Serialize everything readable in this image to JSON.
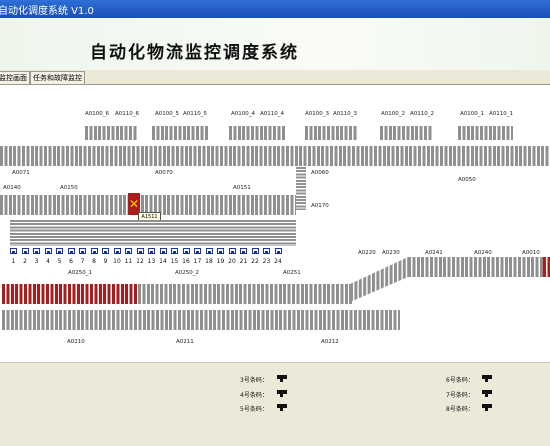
{
  "window": {
    "title": "自动化调度系统  V1.0"
  },
  "header": {
    "title": "自动化物流监控调度系统"
  },
  "tabs": [
    {
      "label": "监控画面"
    },
    {
      "label": "任务和故障监控"
    }
  ],
  "stations": {
    "top_labels": [
      "A0100_6",
      "A0110_6",
      "A0100_5",
      "A0110_5",
      "A0100_4",
      "A0110_4",
      "A0100_3",
      "A0110_3",
      "A0100_2",
      "A0110_2",
      "A0100_1",
      "A0110_1"
    ],
    "a0071": "A0071",
    "a0070": "A0070",
    "a0060": "A0060",
    "a0050": "A0050",
    "a0140": "A0140",
    "a0150": "A0150",
    "a0151": "A0151",
    "a0170": "A0170",
    "a1511": "A1511",
    "a0220": "A0220",
    "a0230": "A0230",
    "a0241": "A0241",
    "a0240": "A0240",
    "a0010": "A0010",
    "a0250_1": "A0250_1",
    "a0250_2": "A0250_2",
    "a0251": "A0251",
    "a0210": "A0210",
    "a0211": "A0211",
    "a0212": "A0212"
  },
  "slot_numbers": [
    "1",
    "2",
    "3",
    "4",
    "5",
    "6",
    "7",
    "8",
    "9",
    "10",
    "11",
    "12",
    "13",
    "14",
    "15",
    "16",
    "17",
    "18",
    "19",
    "20",
    "21",
    "22",
    "23",
    "24"
  ],
  "colors": {
    "conveyor": "#8f8f8f",
    "occupied": "#a81c1c",
    "slot_border": "#1830a0",
    "alarm_icon": "#e83b1a"
  },
  "scanners": [
    {
      "label": "3号条码：",
      "icon": "barcode-scanner-icon"
    },
    {
      "label": "6号条码：",
      "icon": "barcode-scanner-icon"
    },
    {
      "label": "4号条码：",
      "icon": "barcode-scanner-icon"
    },
    {
      "label": "7号条码：",
      "icon": "barcode-scanner-icon"
    },
    {
      "label": "5号条码：",
      "icon": "barcode-scanner-icon"
    },
    {
      "label": "8号条码：",
      "icon": "barcode-scanner-icon"
    }
  ]
}
